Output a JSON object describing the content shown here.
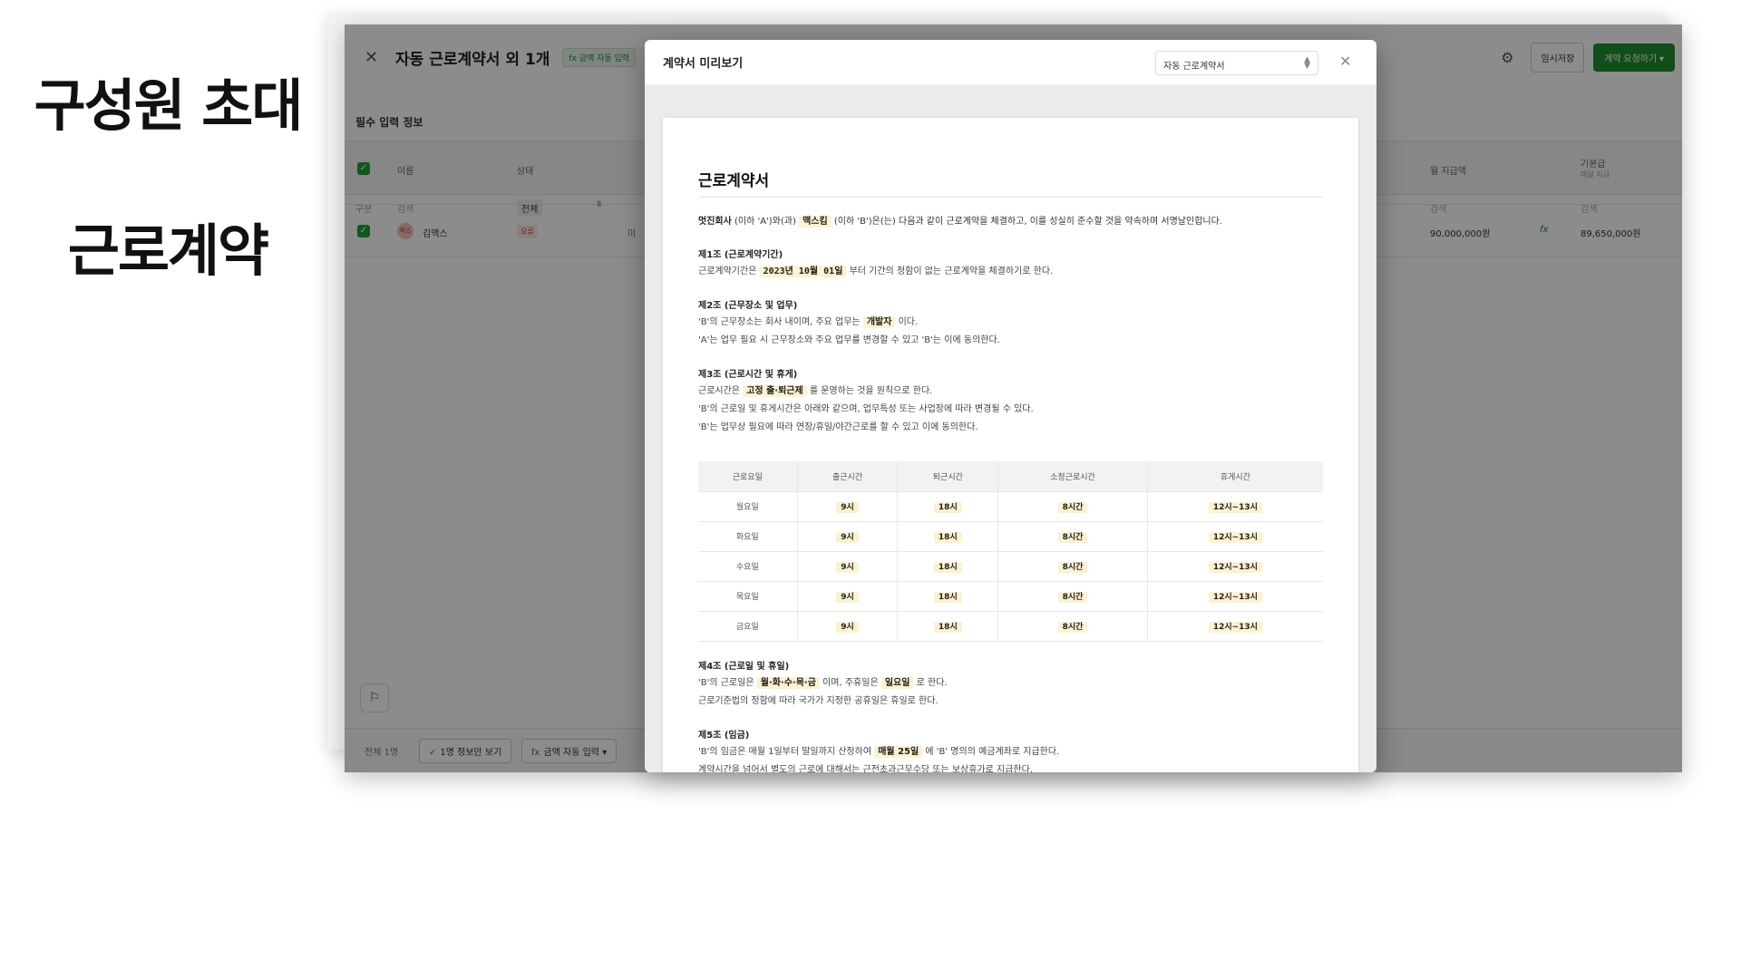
{
  "slide": {
    "title1": "구성원 초대",
    "title2": "근로계약"
  },
  "app": {
    "window_title": "자동 근로계약서 외 1개",
    "badge": "fx 금액 자동 입력",
    "save_label": "임시저장",
    "request_label": "계약 요청하기",
    "section_title": "필수 입력 정보",
    "columns": {
      "name": "이름",
      "status": "상태",
      "monthly_pay": "월 지급액",
      "base_pay": "기본급",
      "base_pay_sub": "매월 지급"
    },
    "filter": {
      "category": "구분",
      "search": "검색",
      "all": "전체",
      "search2": "검색",
      "search3": "검색"
    },
    "row": {
      "avatar": "맥스",
      "name": "김맥스",
      "status": "오류",
      "cut": "미",
      "monthly": "90,000,000원",
      "base": "89,650,000원"
    },
    "footer": {
      "count": "전체 1명",
      "view_one": "1명 정보만 보기",
      "auto_fill": "금액 자동 입력"
    }
  },
  "modal": {
    "title": "계약서 미리보기",
    "select_value": "자동 근로계약서",
    "doc": {
      "title": "근로계약서",
      "intro_a": "멋진회사",
      "intro_b": " (이하 'A')와(과) ",
      "intro_name": "맥스킴",
      "intro_c": " (이하 'B')은(는) 다음과 같이 근로계약을 체결하고, 이를 성실히 준수할 것을 약속하며 서명날인합니다.",
      "a1_title": "제1조 (근로계약기간)",
      "a1_l1_a": "근로계약기간은 ",
      "a1_l1_date": "2023년 10월 01일",
      "a1_l1_b": " 부터 기간의 정함이 없는 근로계약을 체결하기로 한다.",
      "a2_title": "제2조 (근무장소 및 업무)",
      "a2_l1_a": "'B'의 근무장소는 회사 내이며, 주요 업무는 ",
      "a2_l1_job": "개발자",
      "a2_l1_b": " 이다.",
      "a2_l2": "'A'는 업무 필요 시 근무장소와 주요 업무를 변경할 수 있고 'B'는 이에 동의한다.",
      "a3_title": "제3조 (근로시간 및 휴게)",
      "a3_l1_a": "근로시간은 ",
      "a3_l1_type": "고정 출·퇴근제",
      "a3_l1_b": " 를 운영하는 것을 원칙으로 한다.",
      "a3_l2": "'B'의 근로일 및 휴게시간은 아래와 같으며, 업무특성 또는 사업장에 따라 변경될 수 있다.",
      "a3_l3": "'B'는 업무상 필요에 따라 연장/휴일/야간근로를 할 수 있고 이에 동의한다.",
      "table_headers": [
        "근로요일",
        "출근시간",
        "퇴근시간",
        "소정근로시간",
        "휴게시간"
      ],
      "table_rows": [
        [
          "월요일",
          "9시",
          "18시",
          "8시간",
          "12시~13시"
        ],
        [
          "화요일",
          "9시",
          "18시",
          "8시간",
          "12시~13시"
        ],
        [
          "수요일",
          "9시",
          "18시",
          "8시간",
          "12시~13시"
        ],
        [
          "목요일",
          "9시",
          "18시",
          "8시간",
          "12시~13시"
        ],
        [
          "금요일",
          "9시",
          "18시",
          "8시간",
          "12시~13시"
        ]
      ],
      "a4_title": "제4조 (근로일 및 휴일)",
      "a4_l1_a": "'B'의 근로일은 ",
      "a4_l1_days": "월·화·수·목·금",
      "a4_l1_b": " 이며, 주휴일은 ",
      "a4_l1_off": "일요일",
      "a4_l1_c": " 로 한다.",
      "a4_l2": "근로기준법의 정함에 따라 국가가 지정한 공휴일은 휴일로 한다.",
      "a5_title": "제5조 (임금)",
      "a5_l1_a": "'B'의 임금은 매월 1일부터 말일까지 산정하여 ",
      "a5_l1_pay": "매월 25일",
      "a5_l1_b": " 에 'B' 명의의 예금계좌로 지급한다.",
      "a5_l2": "계약시간을 넘어서 별도의 근로에 대해서는 근전초과근무수당 또는 보상휴가로 지급한다."
    }
  }
}
